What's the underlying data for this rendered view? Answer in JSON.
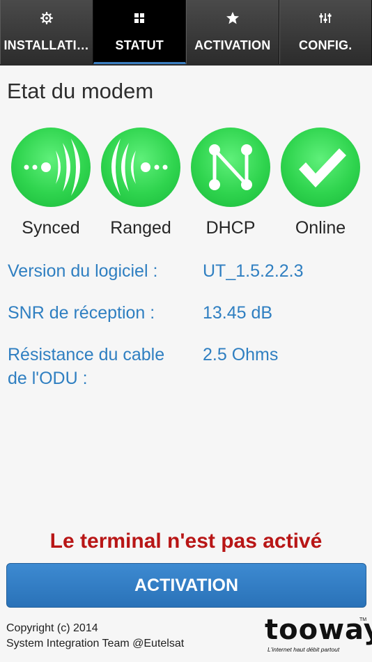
{
  "tabs": [
    {
      "label": "INSTALLATI…",
      "icon": "gear-icon",
      "active": false
    },
    {
      "label": "STATUT",
      "icon": "grid-icon",
      "active": true
    },
    {
      "label": "ACTIVATION",
      "icon": "star-icon",
      "active": false
    },
    {
      "label": "CONFIG.",
      "icon": "sliders-icon",
      "active": false
    }
  ],
  "title": "Etat du modem",
  "status_items": [
    {
      "label": "Synced",
      "icon": "synced-signal-icon"
    },
    {
      "label": "Ranged",
      "icon": "ranged-signal-icon"
    },
    {
      "label": "DHCP",
      "icon": "dhcp-network-icon"
    },
    {
      "label": "Online",
      "icon": "checkmark-icon"
    }
  ],
  "info": {
    "software": {
      "label": "Version du logiciel :",
      "value": "UT_1.5.2.2.3"
    },
    "snr": {
      "label": "SNR de réception :",
      "value": "13.45 dB"
    },
    "resistance": {
      "label_line1": "Résistance du cable",
      "label_line2": "de l'ODU :",
      "value": "2.5 Ohms"
    }
  },
  "warning": "Le terminal n'est pas activé",
  "activation_button": "ACTIVATION",
  "footer": {
    "line1": "Copyright (c) 2014",
    "line2": "System Integration Team @Eutelsat"
  },
  "logo": {
    "word": "tooway",
    "tm": "TM",
    "tagline": "L'internet haut débit partout"
  },
  "colors": {
    "status_green": "#2fd44e",
    "info_blue": "#2f7fc1",
    "warning_red": "#b81616",
    "button_blue": "#3380c6"
  }
}
